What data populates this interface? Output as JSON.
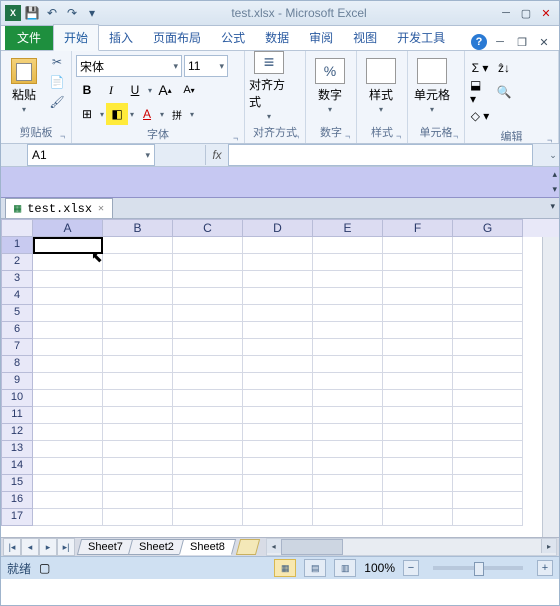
{
  "title": "test.xlsx - Microsoft Excel",
  "qat": {
    "save": "💾",
    "undo": "↶",
    "redo": "↷",
    "dd": "▾"
  },
  "wincontrols": {
    "min": "─",
    "max": "▢",
    "close": "✕"
  },
  "tabs": {
    "file": "文件",
    "home": "开始",
    "insert": "插入",
    "layout": "页面布局",
    "formulas": "公式",
    "data": "数据",
    "review": "审阅",
    "view": "视图",
    "dev": "开发工具"
  },
  "help": "?",
  "mdicontrols": {
    "min": "─",
    "restore": "❐",
    "close": "✕"
  },
  "ribbon": {
    "clipboard": {
      "paste": "粘贴",
      "label": "剪贴板"
    },
    "font": {
      "name": "宋体",
      "size": "11",
      "label": "字体",
      "bold": "B",
      "italic": "I",
      "underline": "U",
      "grow": "A",
      "shrink": "A",
      "phonetic": "拼",
      "border": "⊞",
      "fill": "◧",
      "color": "A"
    },
    "align": {
      "btn": "对齐方式",
      "label": "对齐方式"
    },
    "number": {
      "btn": "数字",
      "label": "数字"
    },
    "styles": {
      "btn": "样式",
      "label": "样式"
    },
    "cells": {
      "btn": "单元格",
      "label": "单元格"
    },
    "editing": {
      "sum": "Σ ▾",
      "fill": "⬓ ▾",
      "clear": "◇ ▾",
      "sort": "ẑ↓",
      "find": "🔍",
      "label": "编辑"
    }
  },
  "namebox": "A1",
  "fx": "fx",
  "workbook_tab": "test.xlsx",
  "columns": [
    "A",
    "B",
    "C",
    "D",
    "E",
    "F",
    "G"
  ],
  "rows": [
    "1",
    "2",
    "3",
    "4",
    "5",
    "6",
    "7",
    "8",
    "9",
    "10",
    "11",
    "12",
    "13",
    "14",
    "15",
    "16",
    "17"
  ],
  "sheet_nav": {
    "first": "|◂",
    "prev": "◂",
    "next": "▸",
    "last": "▸|"
  },
  "sheets": [
    "Sheet7",
    "Sheet2",
    "Sheet8"
  ],
  "active_sheet": 2,
  "status": {
    "ready": "就绪",
    "rec": "▢",
    "zoom": "100%",
    "minus": "−",
    "plus": "+"
  },
  "views": {
    "normal": "▦",
    "layout": "▤",
    "pbreak": "▥"
  },
  "cursor": "⬉"
}
